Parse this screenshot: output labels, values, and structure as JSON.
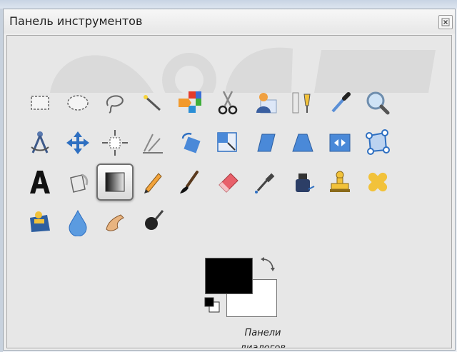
{
  "window": {
    "title": "Панель инструментов"
  },
  "tools": [
    {
      "name": "rect-select-tool-icon",
      "icon": "rect-select"
    },
    {
      "name": "ellipse-select-tool-icon",
      "icon": "ellipse-select"
    },
    {
      "name": "lasso-tool-icon",
      "icon": "lasso"
    },
    {
      "name": "fuzzy-select-tool-icon",
      "icon": "magic-wand"
    },
    {
      "name": "color-select-tool-icon",
      "icon": "color-select"
    },
    {
      "name": "scissors-tool-icon",
      "icon": "scissors"
    },
    {
      "name": "foreground-select-tool-icon",
      "icon": "foreground-select"
    },
    {
      "name": "paths-tool-icon",
      "icon": "paths"
    },
    {
      "name": "color-picker-tool-icon",
      "icon": "eyedropper"
    },
    {
      "name": "zoom-tool-icon",
      "icon": "magnifier"
    },
    {
      "name": "measure-tool-icon",
      "icon": "compass"
    },
    {
      "name": "move-tool-icon",
      "icon": "move"
    },
    {
      "name": "align-tool-icon",
      "icon": "align"
    },
    {
      "name": "crop-tool-icon",
      "icon": "crop"
    },
    {
      "name": "rotate-tool-icon",
      "icon": "rotate"
    },
    {
      "name": "scale-tool-icon",
      "icon": "scale"
    },
    {
      "name": "shear-tool-icon",
      "icon": "shear"
    },
    {
      "name": "perspective-tool-icon",
      "icon": "perspective"
    },
    {
      "name": "flip-tool-icon",
      "icon": "flip"
    },
    {
      "name": "cage-transform-tool-icon",
      "icon": "cage"
    },
    {
      "name": "text-tool-icon",
      "icon": "text"
    },
    {
      "name": "bucket-fill-tool-icon",
      "icon": "bucket"
    },
    {
      "name": "blend-tool-icon",
      "icon": "gradient",
      "active": true
    },
    {
      "name": "pencil-tool-icon",
      "icon": "pencil"
    },
    {
      "name": "paintbrush-tool-icon",
      "icon": "brush"
    },
    {
      "name": "eraser-tool-icon",
      "icon": "eraser"
    },
    {
      "name": "airbrush-tool-icon",
      "icon": "airbrush"
    },
    {
      "name": "ink-tool-icon",
      "icon": "ink"
    },
    {
      "name": "clone-tool-icon",
      "icon": "stamp"
    },
    {
      "name": "heal-tool-icon",
      "icon": "bandage"
    },
    {
      "name": "perspective-clone-tool-icon",
      "icon": "perspective-clone"
    },
    {
      "name": "blur-sharpen-tool-icon",
      "icon": "drop"
    },
    {
      "name": "smudge-tool-icon",
      "icon": "finger"
    },
    {
      "name": "dodge-burn-tool-icon",
      "icon": "dodge-burn"
    }
  ],
  "colors": {
    "foreground": "#000000",
    "background": "#ffffff",
    "active_border": "#6f6f6f"
  },
  "dialogs_label": "Панели диалогов"
}
